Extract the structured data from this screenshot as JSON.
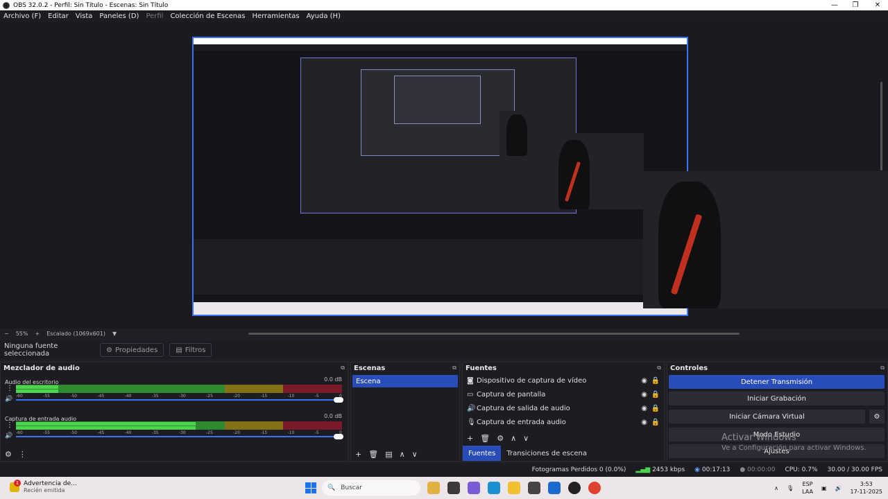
{
  "window": {
    "title": "OBS 32.0.2 - Perfil: Sin Título - Escenas: Sin Título",
    "controls": [
      "—",
      "❐",
      "✕"
    ]
  },
  "menu": [
    "Archivo (F)",
    "Editar",
    "Vista",
    "Paneles (D)",
    "Perfil",
    "Colección de Escenas",
    "Herramientas",
    "Ayuda (H)"
  ],
  "zoom": {
    "minus": "−",
    "value": "55%",
    "plus": "+",
    "scaling": "Escalado (1069x601)"
  },
  "source_toolbar": {
    "none_selected": "Ninguna fuente seleccionada",
    "properties": "Propiedades",
    "filters": "Filtros"
  },
  "mixer": {
    "title": "Mezclador de audio",
    "tracks": [
      {
        "name": "Audio del escritorio",
        "db": "0.0 dB",
        "level": 0.13
      },
      {
        "name": "Captura de entrada audio",
        "db": "0.0 dB",
        "level": 0.55
      }
    ],
    "ticks": [
      "-60",
      "-55",
      "-50",
      "-45",
      "-40",
      "-35",
      "-30",
      "-25",
      "-20",
      "-15",
      "-10",
      "-5",
      "0"
    ]
  },
  "scenes": {
    "title": "Escenas",
    "items": [
      "Escena"
    ]
  },
  "sources": {
    "title": "Fuentes",
    "items": [
      {
        "name": "Dispositivo de captura de vídeo",
        "icon": "camera-icon"
      },
      {
        "name": "Captura de pantalla",
        "icon": "monitor-icon"
      },
      {
        "name": "Captura de salida de audio",
        "icon": "speaker-icon"
      },
      {
        "name": "Captura de entrada audio",
        "icon": "mic-icon"
      }
    ],
    "tabs": [
      "Fuentes",
      "Transiciones de escena"
    ]
  },
  "controls": {
    "title": "Controles",
    "buttons": [
      "Detener Transmisión",
      "Iniciar Grabación",
      "Iniciar Cámara Virtual",
      "Modo Estudio",
      "Ajustes"
    ]
  },
  "watermark": {
    "line1": "Activar Windows",
    "line2": "Ve a Configuración para activar Windows."
  },
  "status": {
    "dropped": "Fotogramas Perdidos 0 (0.0%)",
    "bitrate": "2453 kbps",
    "stream_time": "00:17:13",
    "rec_time": "00:00:00",
    "cpu": "CPU: 0.7%",
    "fps": "30.00 / 30.00 FPS"
  },
  "taskbar": {
    "notif_title": "Advertencia de...",
    "notif_sub": "Recién emitida",
    "notif_badge": "1",
    "search": "Buscar",
    "lang1": "ESP",
    "lang2": "LAA",
    "time": "3:53",
    "date": "17-11-2025"
  },
  "colors": {
    "accent": "#284cb8",
    "meter_green": "#4cd44c",
    "meter_yellow": "#d4b43a",
    "meter_red": "#c0304a"
  }
}
